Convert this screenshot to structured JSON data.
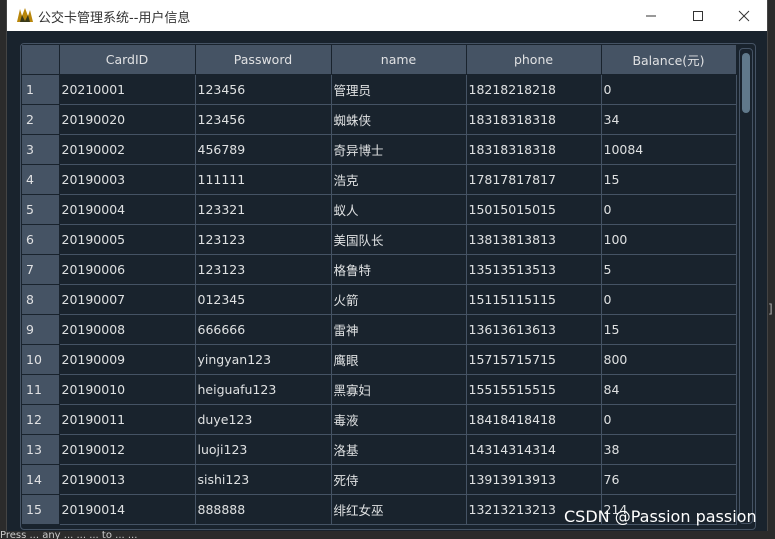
{
  "window": {
    "title": "公交卡管理系统--用户信息"
  },
  "table": {
    "columns": [
      "CardID",
      "Password",
      "name",
      "phone",
      "Balance(元)"
    ],
    "rows": [
      {
        "num": "1",
        "cells": [
          "20210001",
          "123456",
          "管理员",
          "18218218218",
          "0"
        ]
      },
      {
        "num": "2",
        "cells": [
          "20190020",
          "123456",
          "蜘蛛侠",
          "18318318318",
          "34"
        ]
      },
      {
        "num": "3",
        "cells": [
          "20190002",
          "456789",
          "奇异博士",
          "18318318318",
          "10084"
        ]
      },
      {
        "num": "4",
        "cells": [
          "20190003",
          "111111",
          "浩克",
          "17817817817",
          "15"
        ]
      },
      {
        "num": "5",
        "cells": [
          "20190004",
          "123321",
          "蚁人",
          "15015015015",
          "0"
        ]
      },
      {
        "num": "6",
        "cells": [
          "20190005",
          "123123",
          "美国队长",
          "13813813813",
          "100"
        ]
      },
      {
        "num": "7",
        "cells": [
          "20190006",
          "123123",
          "格鲁特",
          "13513513513",
          "5"
        ]
      },
      {
        "num": "8",
        "cells": [
          "20190007",
          "012345",
          "火箭",
          "15115115115",
          "0"
        ]
      },
      {
        "num": "9",
        "cells": [
          "20190008",
          "666666",
          "雷神",
          "13613613613",
          "15"
        ]
      },
      {
        "num": "10",
        "cells": [
          "20190009",
          "yingyan123",
          "鹰眼",
          "15715715715",
          "800"
        ]
      },
      {
        "num": "11",
        "cells": [
          "20190010",
          "heiguafu123",
          "黑寡妇",
          "15515515515",
          "84"
        ]
      },
      {
        "num": "12",
        "cells": [
          "20190011",
          "duye123",
          "毒液",
          "18418418418",
          "0"
        ]
      },
      {
        "num": "13",
        "cells": [
          "20190012",
          "luoji123",
          "洛基",
          "14314314314",
          "38"
        ]
      },
      {
        "num": "14",
        "cells": [
          "20190013",
          "sishi123",
          "死侍",
          "13913913913",
          "76"
        ]
      },
      {
        "num": "15",
        "cells": [
          "20190014",
          "888888",
          "绯红女巫",
          "13213213213",
          "214"
        ]
      }
    ]
  },
  "watermark": "CSDN @Passion passion",
  "background_text": {
    "bracket": "]",
    "bottom": "Press ... any ... ... ... to ... ..."
  },
  "icons": {
    "app": "app-logo-icon",
    "minimize": "minimize-icon",
    "maximize": "maximize-icon",
    "close": "close-icon"
  },
  "colors": {
    "window_bg": "#19232d",
    "header_bg": "#455364",
    "grid": "#455364",
    "text": "#dfe1e2"
  }
}
